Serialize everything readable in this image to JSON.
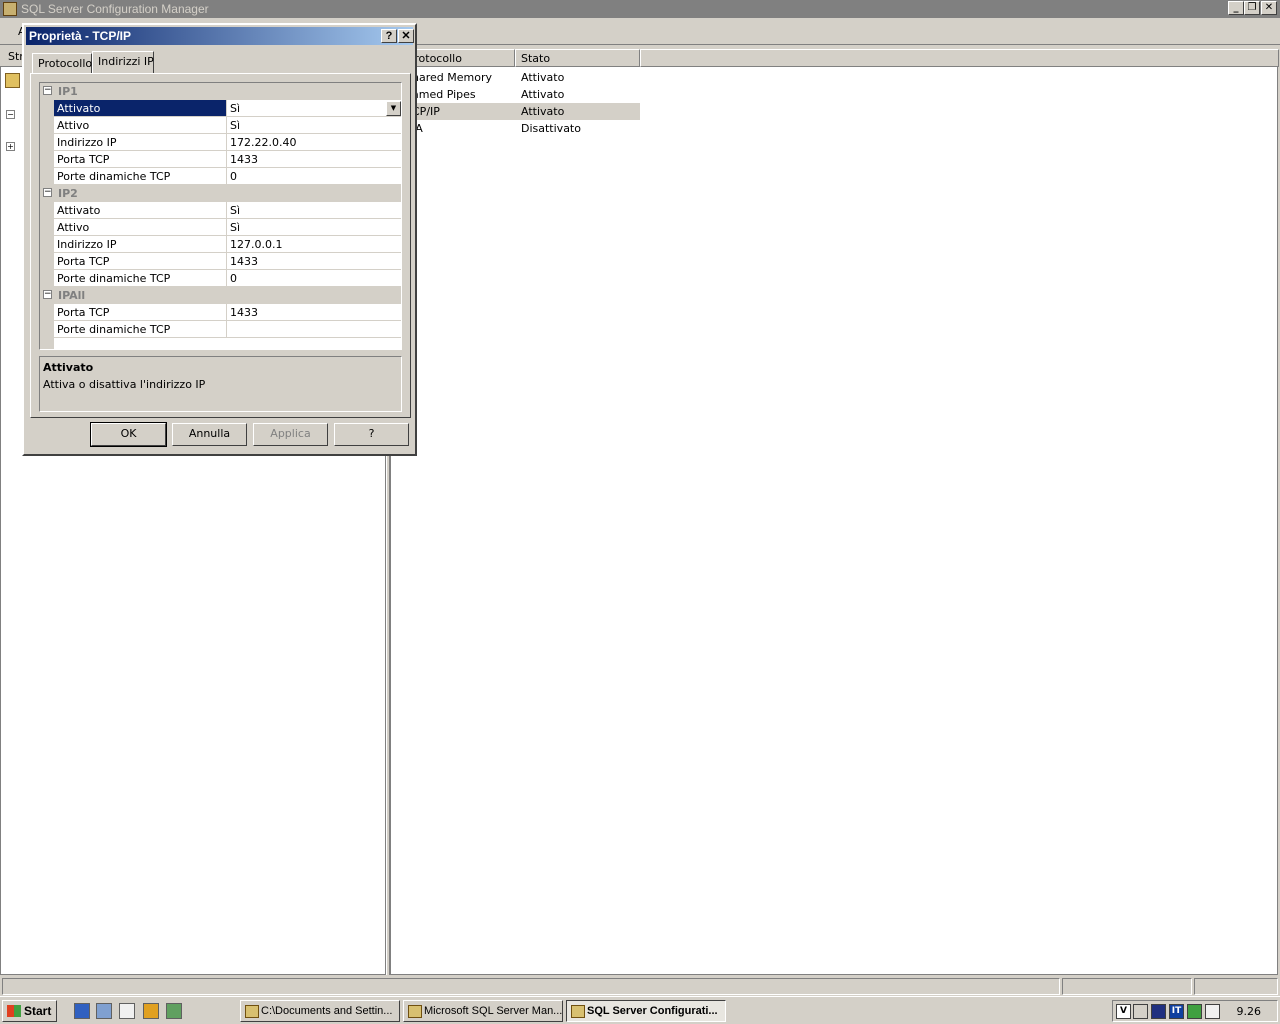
{
  "main_window": {
    "title": "SQL Server Configuration Manager",
    "menu_first": "A",
    "toolbar_first": "Str",
    "buttons": {
      "minimize": "_",
      "restore": "❐",
      "close": "✕"
    }
  },
  "protocol_list": {
    "columns": [
      "e protocollo",
      "Stato"
    ],
    "rows": [
      {
        "name": "hared Memory",
        "state": "Attivato"
      },
      {
        "name": "amed Pipes",
        "state": "Attivato"
      },
      {
        "name": "CP/IP",
        "state": "Attivato"
      },
      {
        "name": "IA",
        "state": "Disattivato"
      }
    ]
  },
  "dialog": {
    "title": "Proprietà - TCP/IP",
    "help_glyph": "?",
    "close_glyph": "✕",
    "tabs": [
      "Protocollo",
      "Indirizzi IP"
    ],
    "groups": [
      {
        "name": "IP1",
        "rows": [
          {
            "name": "Attivato",
            "value": "Sì"
          },
          {
            "name": "Attivo",
            "value": "Sì"
          },
          {
            "name": "Indirizzo IP",
            "value": "172.22.0.40"
          },
          {
            "name": "Porta TCP",
            "value": "1433"
          },
          {
            "name": "Porte dinamiche TCP",
            "value": "0"
          }
        ]
      },
      {
        "name": "IP2",
        "rows": [
          {
            "name": "Attivato",
            "value": "Sì"
          },
          {
            "name": "Attivo",
            "value": "Sì"
          },
          {
            "name": "Indirizzo IP",
            "value": "127.0.0.1"
          },
          {
            "name": "Porta TCP",
            "value": "1433"
          },
          {
            "name": "Porte dinamiche TCP",
            "value": "0"
          }
        ]
      },
      {
        "name": "IPAll",
        "rows": [
          {
            "name": "Porta TCP",
            "value": "1433"
          },
          {
            "name": "Porte dinamiche TCP",
            "value": ""
          }
        ]
      }
    ],
    "collapse_glyph": "−",
    "dropdown_glyph": "▼",
    "description": {
      "title": "Attivato",
      "text": "Attiva o disattiva l'indirizzo IP"
    },
    "buttons": {
      "ok": "OK",
      "cancel": "Annulla",
      "apply": "Applica",
      "help": "?"
    }
  },
  "taskbar": {
    "start": "Start",
    "tasks": [
      "C:\\Documents and Settin...",
      "Microsoft SQL Server Man...",
      "SQL Server Configurati..."
    ],
    "tray": [
      "V",
      "IT"
    ],
    "clock": "9.26"
  },
  "left_tree": {
    "expand_minus": "−",
    "expand_plus": "+"
  }
}
